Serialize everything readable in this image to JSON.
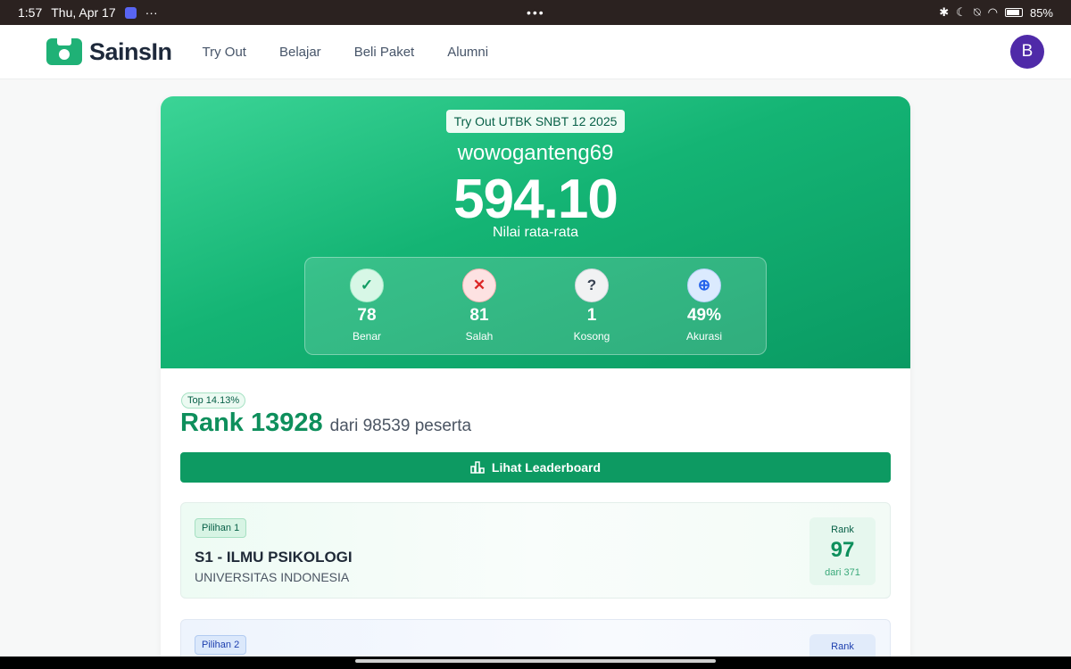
{
  "statusbar": {
    "time": "1:57",
    "date": "Thu, Apr 17",
    "more": "···",
    "center_dots": "•••",
    "battery": "85%"
  },
  "nav": {
    "brand": "SainsIn",
    "links": [
      "Try Out",
      "Belajar",
      "Beli Paket",
      "Alumni"
    ],
    "avatar_initial": "B"
  },
  "hero": {
    "exam_name": "Try Out UTBK SNBT 12 2025",
    "username": "wowoganteng69",
    "score": "594.10",
    "score_label": "Nilai rata-rata",
    "stats": [
      {
        "icon": "check-icon",
        "value": "78",
        "label": "Benar"
      },
      {
        "icon": "x-icon",
        "value": "81",
        "label": "Salah"
      },
      {
        "icon": "question-icon",
        "value": "1",
        "label": "Kosong"
      },
      {
        "icon": "target-icon",
        "value": "49%",
        "label": "Akurasi"
      }
    ]
  },
  "rank": {
    "top_badge": "Top 14.13%",
    "rank_text": "Rank 13928",
    "of_text": "dari 98539 peserta",
    "leaderboard_button": "Lihat Leaderboard"
  },
  "choices": [
    {
      "pill": "Pilihan 1",
      "program": "S1 - ILMU PSIKOLOGI",
      "university": "UNIVERSITAS INDONESIA",
      "rank_label": "Rank",
      "rank_value": "97",
      "rank_of": "dari 371"
    },
    {
      "pill": "Pilihan 2",
      "rank_label": "Rank"
    }
  ],
  "colors": {
    "brand": "#1fb176",
    "primary_button": "#0d9a62",
    "rank_text": "#0e8f5c",
    "avatar": "#4f2aa8"
  }
}
